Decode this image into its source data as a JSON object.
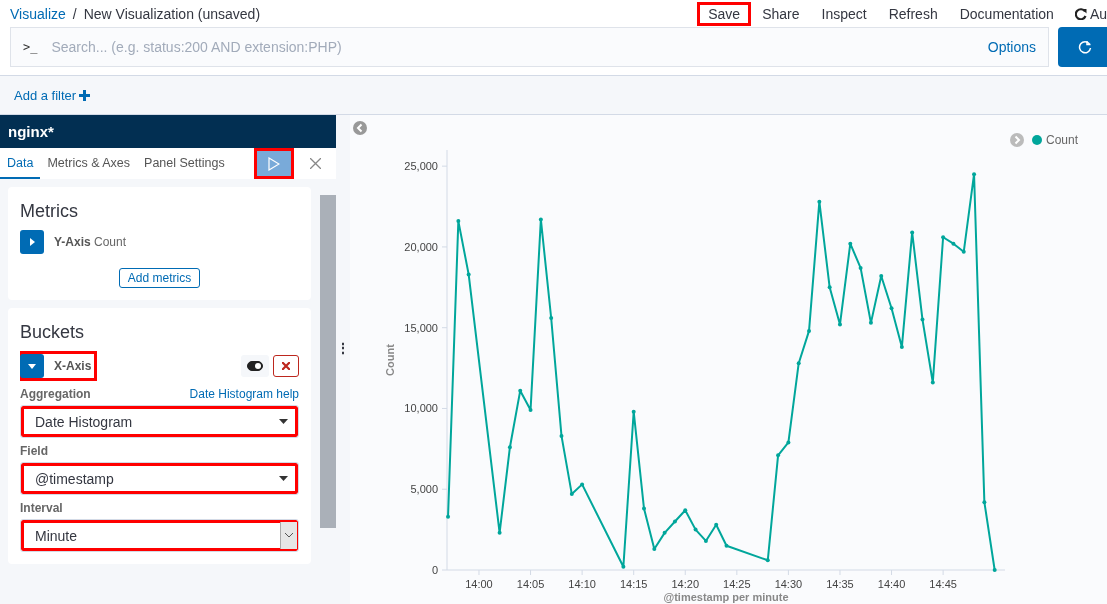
{
  "breadcrumb": {
    "link": "Visualize",
    "separator": "/",
    "current": "New Visualization (unsaved)"
  },
  "top_nav": [
    {
      "label": "Save",
      "highlighted": true
    },
    {
      "label": "Share",
      "highlighted": false
    },
    {
      "label": "Inspect",
      "highlighted": false
    },
    {
      "label": "Refresh",
      "highlighted": false
    },
    {
      "label": "Documentation",
      "highlighted": false
    }
  ],
  "auto_refresh": {
    "label": "Au"
  },
  "search": {
    "prompt": ">_",
    "placeholder": "Search... (e.g. status:200 AND extension:PHP)",
    "options": "Options"
  },
  "filter_bar": {
    "add_filter": "Add a filter"
  },
  "editor": {
    "index_pattern": "nginx*",
    "tabs": [
      {
        "label": "Data",
        "selected": true
      },
      {
        "label": "Metrics & Axes",
        "selected": false
      },
      {
        "label": "Panel Settings",
        "selected": false
      }
    ],
    "apply_button": {
      "highlighted": true
    },
    "metrics": {
      "title": "Metrics",
      "items": [
        {
          "label": "**Y-Axis** Count",
          "expanded": false
        }
      ],
      "add_button": "Add metrics"
    },
    "buckets": {
      "title": "Buckets",
      "items": [
        {
          "label": "X-Axis",
          "expanded": true,
          "highlighted": true,
          "enabled": true,
          "fields": [
            {
              "label": "Aggregation",
              "help_link": "Date Histogram help",
              "value": "Date Histogram",
              "kind": "combo",
              "highlighted": true
            },
            {
              "label": "Field",
              "value": "@timestamp",
              "kind": "combo",
              "highlighted": true
            },
            {
              "label": "Interval",
              "value": "Minute",
              "kind": "native",
              "highlighted": true
            }
          ]
        }
      ]
    }
  },
  "resizer": "⋮",
  "chart": {
    "chart_data": {
      "type": "line",
      "xlabel": "@timestamp per minute",
      "ylabel": "Count",
      "categories": [
        null,
        null,
        null,
        "14:00",
        null,
        null,
        null,
        null,
        "14:05",
        null,
        null,
        null,
        null,
        "14:10",
        null,
        null,
        null,
        null,
        "14:15",
        null,
        null,
        null,
        null,
        "14:20",
        null,
        null,
        null,
        null,
        "14:25",
        null,
        null,
        null,
        null,
        "14:30",
        null,
        null,
        null,
        null,
        "14:35",
        null,
        null,
        null,
        null,
        "14:40",
        null,
        null,
        null,
        null,
        "14:45",
        null,
        null,
        null,
        null,
        null
      ],
      "series": [
        {
          "name": "Count",
          "color": "#00a69b",
          "values": [
            3300,
            21600,
            18300,
            null,
            null,
            2300,
            7600,
            11100,
            9900,
            21700,
            15600,
            8300,
            4700,
            5300,
            null,
            null,
            null,
            200,
            9800,
            3800,
            1300,
            2300,
            3000,
            3700,
            2500,
            1800,
            2800,
            1500,
            null,
            null,
            null,
            600,
            7100,
            7900,
            12800,
            14800,
            22800,
            17500,
            15200,
            20200,
            18700,
            15300,
            18200,
            16200,
            13800,
            20900,
            15500,
            11600,
            20600,
            20200,
            19700,
            24500,
            4200,
            0
          ]
        }
      ],
      "ylim": [
        0,
        26000
      ],
      "yticks": [
        {
          "value": 0,
          "label": "0"
        },
        {
          "value": 5000,
          "label": "5,000"
        },
        {
          "value": 10000,
          "label": "10,000"
        },
        {
          "value": 15000,
          "label": "15,000"
        },
        {
          "value": 20000,
          "label": "20,000"
        },
        {
          "value": 25000,
          "label": "25,000"
        }
      ]
    }
  }
}
